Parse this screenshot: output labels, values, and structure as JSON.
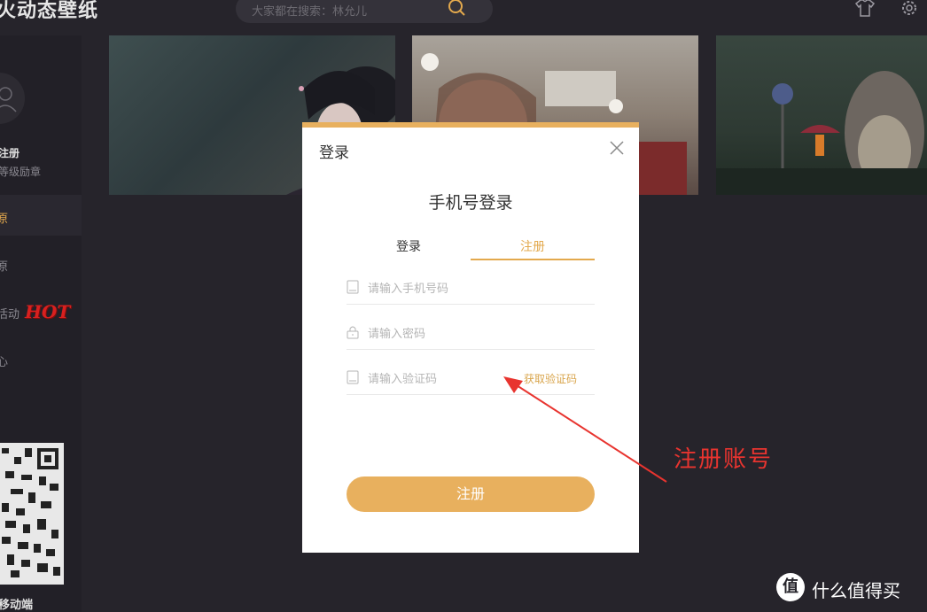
{
  "app": {
    "title": "火动态壁纸"
  },
  "search": {
    "placeholder": "大家都在搜索：林允儿"
  },
  "sidebar": {
    "register_label": "注册",
    "level_label": "等级励章",
    "items": [
      {
        "label": "原",
        "active": true
      },
      {
        "label": "原",
        "active": false
      },
      {
        "label": "活动",
        "active": false
      },
      {
        "label": "心",
        "active": false
      }
    ],
    "hot_badge": "HOT",
    "mobile_label": "移动端"
  },
  "modal": {
    "title": "登录",
    "heading": "手机号登录",
    "tabs": [
      {
        "label": "登录",
        "active": false
      },
      {
        "label": "注册",
        "active": true
      }
    ],
    "phone_placeholder": "请输入手机号码",
    "password_placeholder": "请输入密码",
    "code_placeholder": "请输入验证码",
    "get_code_label": "获取验证码",
    "submit_label": "注册"
  },
  "annotation": {
    "text": "注册账号"
  },
  "watermark": {
    "logo": "值",
    "text": "什么值得买"
  },
  "colors": {
    "accent": "#e8b05e",
    "background": "#26242b",
    "annotation": "#e8342f"
  }
}
